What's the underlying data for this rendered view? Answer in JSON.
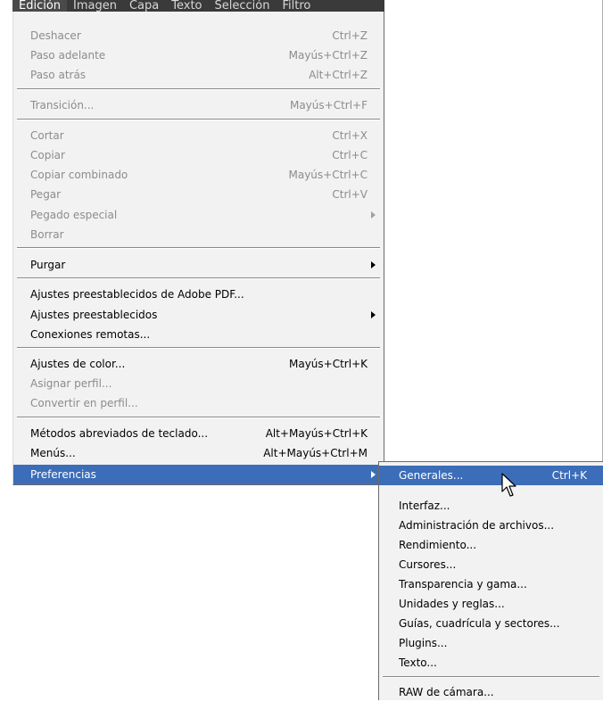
{
  "menubar": {
    "items": [
      "Edición",
      "Imagen",
      "Capa",
      "Texto",
      "Selección",
      "Filtro"
    ]
  },
  "menu": {
    "items": [
      {
        "label": "Deshacer",
        "shortcut": "Ctrl+Z",
        "disabled": true
      },
      {
        "label": "Paso adelante",
        "shortcut": "Mayús+Ctrl+Z",
        "disabled": true
      },
      {
        "label": "Paso atrás",
        "shortcut": "Alt+Ctrl+Z",
        "disabled": true
      },
      {
        "label": "Transición...",
        "shortcut": "Mayús+Ctrl+F",
        "disabled": true
      },
      {
        "label": "Cortar",
        "shortcut": "Ctrl+X",
        "disabled": true
      },
      {
        "label": "Copiar",
        "shortcut": "Ctrl+C",
        "disabled": true
      },
      {
        "label": "Copiar combinado",
        "shortcut": "Mayús+Ctrl+C",
        "disabled": true
      },
      {
        "label": "Pegar",
        "shortcut": "Ctrl+V",
        "disabled": true
      },
      {
        "label": "Pegado especial",
        "shortcut": "",
        "disabled": true,
        "submenu": true
      },
      {
        "label": "Borrar",
        "shortcut": "",
        "disabled": true
      },
      {
        "label": "Purgar",
        "shortcut": "",
        "disabled": false,
        "submenu": true
      },
      {
        "label": "Ajustes preestablecidos de Adobe PDF...",
        "shortcut": "",
        "disabled": false
      },
      {
        "label": "Ajustes preestablecidos",
        "shortcut": "",
        "disabled": false,
        "submenu": true
      },
      {
        "label": "Conexiones remotas...",
        "shortcut": "",
        "disabled": false
      },
      {
        "label": "Ajustes de color...",
        "shortcut": "Mayús+Ctrl+K",
        "disabled": false
      },
      {
        "label": "Asignar perfil...",
        "shortcut": "",
        "disabled": true
      },
      {
        "label": "Convertir en perfil...",
        "shortcut": "",
        "disabled": true
      },
      {
        "label": "Métodos abreviados de teclado...",
        "shortcut": "Alt+Mayús+Ctrl+K",
        "disabled": false
      },
      {
        "label": "Menús...",
        "shortcut": "Alt+Mayús+Ctrl+M",
        "disabled": false
      },
      {
        "label": "Preferencias",
        "shortcut": "",
        "disabled": false,
        "submenu": true,
        "selected": true
      }
    ]
  },
  "submenu": {
    "items": [
      {
        "label": "Generales...",
        "shortcut": "Ctrl+K",
        "selected": true
      },
      {
        "label": "Interfaz...",
        "shortcut": ""
      },
      {
        "label": "Administración de archivos...",
        "shortcut": ""
      },
      {
        "label": "Rendimiento...",
        "shortcut": ""
      },
      {
        "label": "Cursores...",
        "shortcut": ""
      },
      {
        "label": "Transparencia y gama...",
        "shortcut": ""
      },
      {
        "label": "Unidades y reglas...",
        "shortcut": ""
      },
      {
        "label": "Guías, cuadrícula y sectores...",
        "shortcut": ""
      },
      {
        "label": "Plugins...",
        "shortcut": ""
      },
      {
        "label": "Texto...",
        "shortcut": ""
      },
      {
        "label": "RAW de cámara...",
        "shortcut": ""
      }
    ]
  },
  "colors": {
    "highlight": "#3c6db8",
    "menu_bg": "#f2f2f2",
    "menubar_bg": "#3a3a3a",
    "disabled_text": "#8c8c8c"
  }
}
